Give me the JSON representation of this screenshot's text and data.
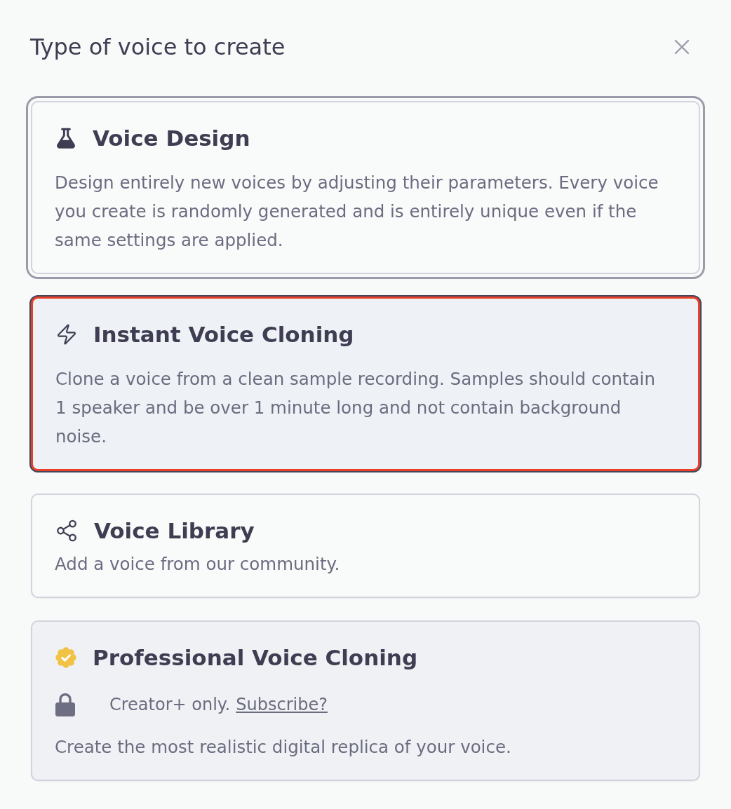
{
  "dialog": {
    "title": "Type of voice to create"
  },
  "options": [
    {
      "kind": "design",
      "title": "Voice Design",
      "description": "Design entirely new voices by adjusting their parameters. Every voice you create is randomly generated and is entirely unique even if the same settings are applied.",
      "selected": false,
      "focused": true,
      "locked": false
    },
    {
      "kind": "instant",
      "title": "Instant Voice Cloning",
      "description": "Clone a voice from a clean sample recording. Samples should contain 1 speaker and be over 1 minute long and not contain background noise.",
      "selected": true,
      "focused": false,
      "locked": false
    },
    {
      "kind": "library",
      "title": "Voice Library",
      "description": "Add a voice from our community.",
      "selected": false,
      "focused": false,
      "locked": false
    },
    {
      "kind": "professional",
      "title": "Professional Voice Cloning",
      "description": "Create the most realistic digital replica of your voice.",
      "selected": false,
      "focused": false,
      "locked": true,
      "lock_note": "Creator+ only.",
      "lock_link": "Subscribe?"
    }
  ]
}
